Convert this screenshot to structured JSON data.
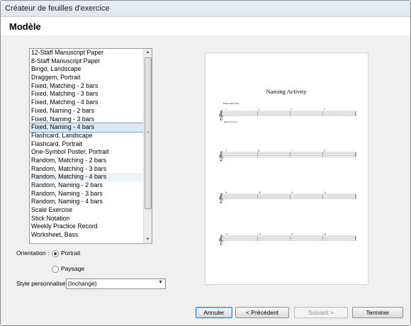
{
  "window": {
    "title": "Créateur de feuilles d'exercice"
  },
  "header": {
    "title": "Modèle"
  },
  "template_list": {
    "items": [
      "12-Staff Manuscript Paper",
      "8-Staff Manuscript Paper",
      "Bingo, Landscape",
      "Draggem, Portrait",
      "Fixed, Matching - 2 bars",
      "Fixed, Matching - 3 bars",
      "Fixed, Matching - 4 bars",
      "Fixed, Naming - 2 bars",
      "Fixed, Naming - 3 bars",
      "Fixed, Naming - 4 bars",
      "Flashcard, Landscape",
      "Flashcard, Portrait",
      "One-Symbol Poster, Portrait",
      "Random, Matching - 2 bars",
      "Random, Matching - 3 bars",
      "Random, Matching - 4 bars",
      "Random, Naming - 2 bars",
      "Random, Naming - 3 bars",
      "Random, Naming - 4 bars",
      "Scale Exercise",
      "Stick Notation",
      "Weekly Practice Record",
      "Worksheet, Bass"
    ],
    "selected": "Fixed, Naming - 4 bars",
    "hovered": "Random, Matching - 4 bars"
  },
  "orientation": {
    "label": "Orientation :",
    "portrait": "Portrait",
    "landscape": "Paysage",
    "selected": "Portrait"
  },
  "style": {
    "label": "Style personnalisé :",
    "value": "(Inchangé)"
  },
  "preview": {
    "title": "Naming Activity",
    "instruction": "Instruction Line",
    "answer_note": "Answer in voice 2.",
    "systems": [
      {
        "measures": [
          "1",
          "2",
          "3",
          "4"
        ]
      },
      {
        "measures": [
          "5",
          "6",
          "7",
          "8"
        ]
      },
      {
        "measures": [
          "9",
          "10",
          "11",
          "12"
        ]
      },
      {
        "measures": [
          "13",
          "14",
          "15",
          "16"
        ]
      }
    ]
  },
  "buttons": {
    "cancel": "Annuler",
    "back": "< Précédent",
    "next": "Suivant >",
    "finish": "Terminer"
  }
}
